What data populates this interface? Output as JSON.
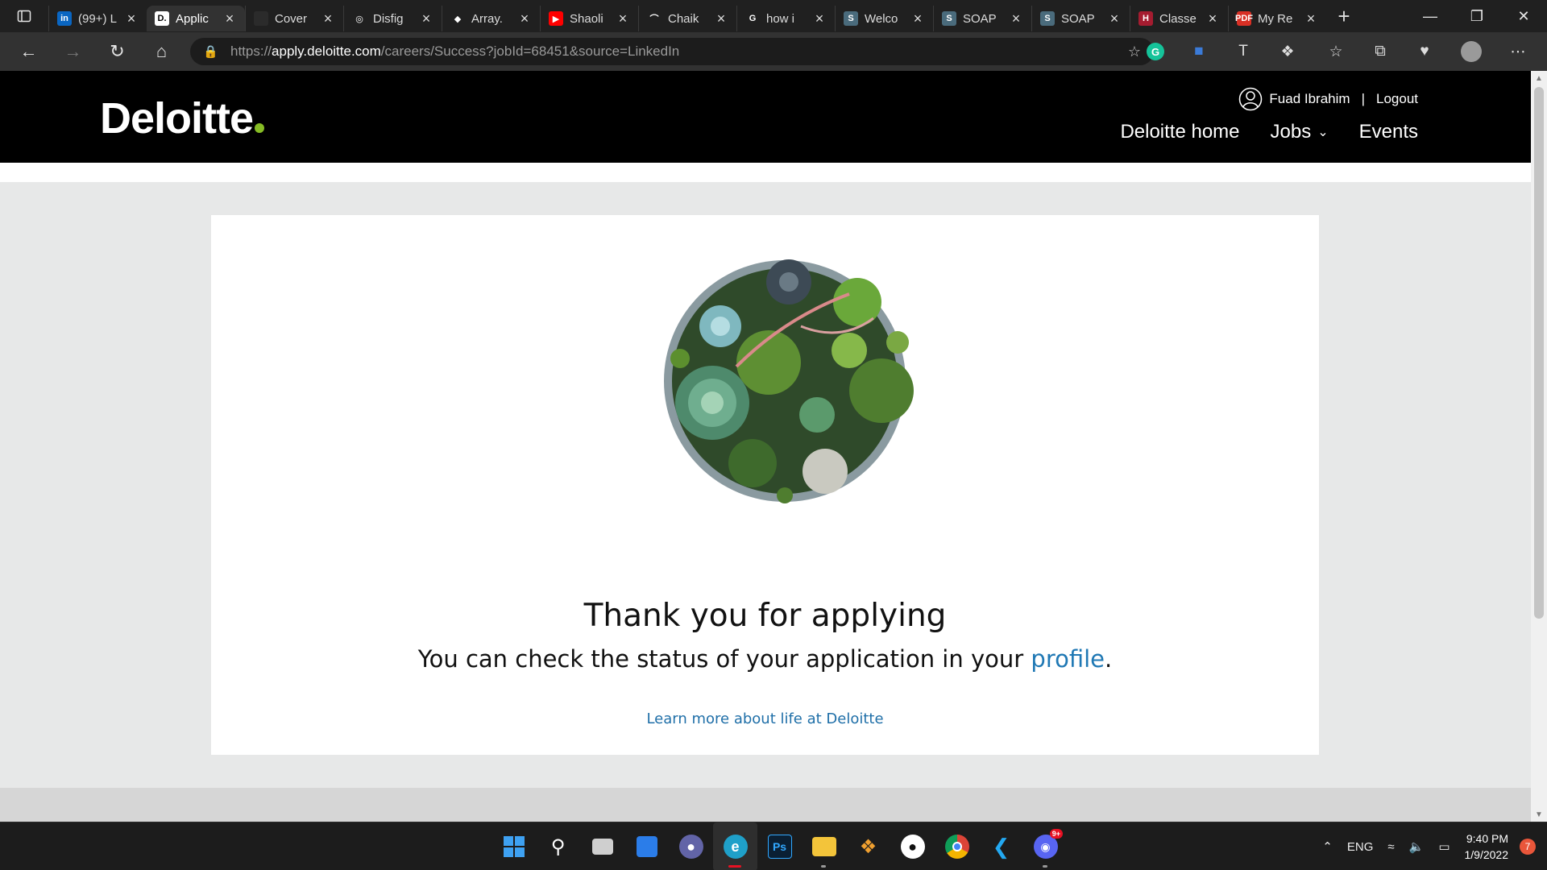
{
  "browser": {
    "tabs": [
      {
        "title": "(99+) L",
        "favicon": "linkedin-icon",
        "color": "#0a66c2",
        "glyph": "in"
      },
      {
        "title": "Applic",
        "favicon": "deloitte-icon",
        "color": "#ffffff",
        "glyph": "D.",
        "active": true
      },
      {
        "title": "Cover",
        "favicon": "document-icon",
        "color": "#2b2b2b",
        "glyph": ""
      },
      {
        "title": "Disfig",
        "favicon": "openai-icon",
        "color": "#202020",
        "glyph": "◎"
      },
      {
        "title": "Array.",
        "favicon": "speech-icon",
        "color": "#202020",
        "glyph": "◆"
      },
      {
        "title": "Shaoli",
        "favicon": "youtube-icon",
        "color": "#ff0000",
        "glyph": "▶"
      },
      {
        "title": "Chaik",
        "favicon": "rainbow-icon",
        "color": "#202020",
        "glyph": "⌒"
      },
      {
        "title": "how i",
        "favicon": "google-icon",
        "color": "#202020",
        "glyph": "G"
      },
      {
        "title": "Welco",
        "favicon": "s-icon",
        "color": "#4a6b7c",
        "glyph": "S"
      },
      {
        "title": "SOAP",
        "favicon": "s-icon",
        "color": "#4a6b7c",
        "glyph": "S"
      },
      {
        "title": "SOAP",
        "favicon": "s-icon",
        "color": "#4a6b7c",
        "glyph": "S"
      },
      {
        "title": "Classe",
        "favicon": "harvard-icon",
        "color": "#a51c30",
        "glyph": "H"
      },
      {
        "title": "My Re",
        "favicon": "pdf-icon",
        "color": "#d93025",
        "glyph": "PDF"
      }
    ],
    "url_scheme": "https://",
    "url_host": "apply.deloitte.com",
    "url_rest": "/careers/Success?jobId=68451&source=LinkedIn"
  },
  "site": {
    "logo_text": "Deloitte",
    "logo_dot_color": "#86bc25",
    "user_name": "Fuad Ibrahim",
    "separator": "|",
    "logout_label": "Logout",
    "nav": {
      "home": "Deloitte home",
      "jobs": "Jobs",
      "events": "Events"
    }
  },
  "content": {
    "headline": "Thank you for applying",
    "subline_prefix": "You can check the status of your application in your ",
    "profile_link": "profile",
    "subline_suffix": ".",
    "learn_more": "Learn more about life at Deloitte",
    "image_alt": "succulent-planter-image"
  },
  "taskbar": {
    "language": "ENG",
    "time": "9:40 PM",
    "date": "1/9/2022",
    "notification_count": "7",
    "discord_badge": "9+"
  }
}
